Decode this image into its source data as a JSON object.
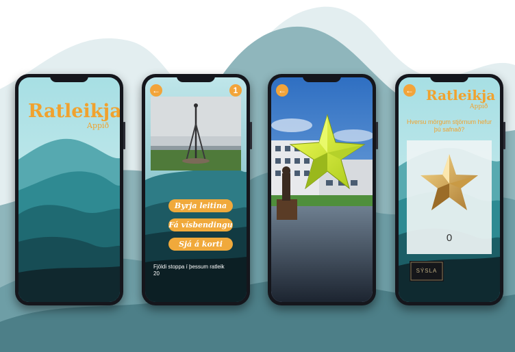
{
  "screens": {
    "home": {
      "logo_title": "Ratleikja",
      "logo_subtitle": "Appið"
    },
    "clue": {
      "back_icon": "arrow-left-icon",
      "stop_number": "1",
      "buttons": [
        "Byrja leitina",
        "Fá vísbendingu",
        "Sjá á korti"
      ],
      "stops_label": "Fjöldi stoppa í þessum ratleik",
      "stops_count": "20"
    },
    "ar": {
      "back_icon": "arrow-left-icon"
    },
    "score": {
      "back_icon": "arrow-left-icon",
      "logo_title": "Ratleikja",
      "logo_subtitle": "Appið",
      "question": "Hversu mörgum stjörnum hefur þú safnað?",
      "star_count": "0",
      "sponsor": "SÝSLA"
    }
  },
  "colors": {
    "accent": "#f0a22e",
    "background_mountain": "#5b9098",
    "screen_sky": "#cfeaf0"
  }
}
